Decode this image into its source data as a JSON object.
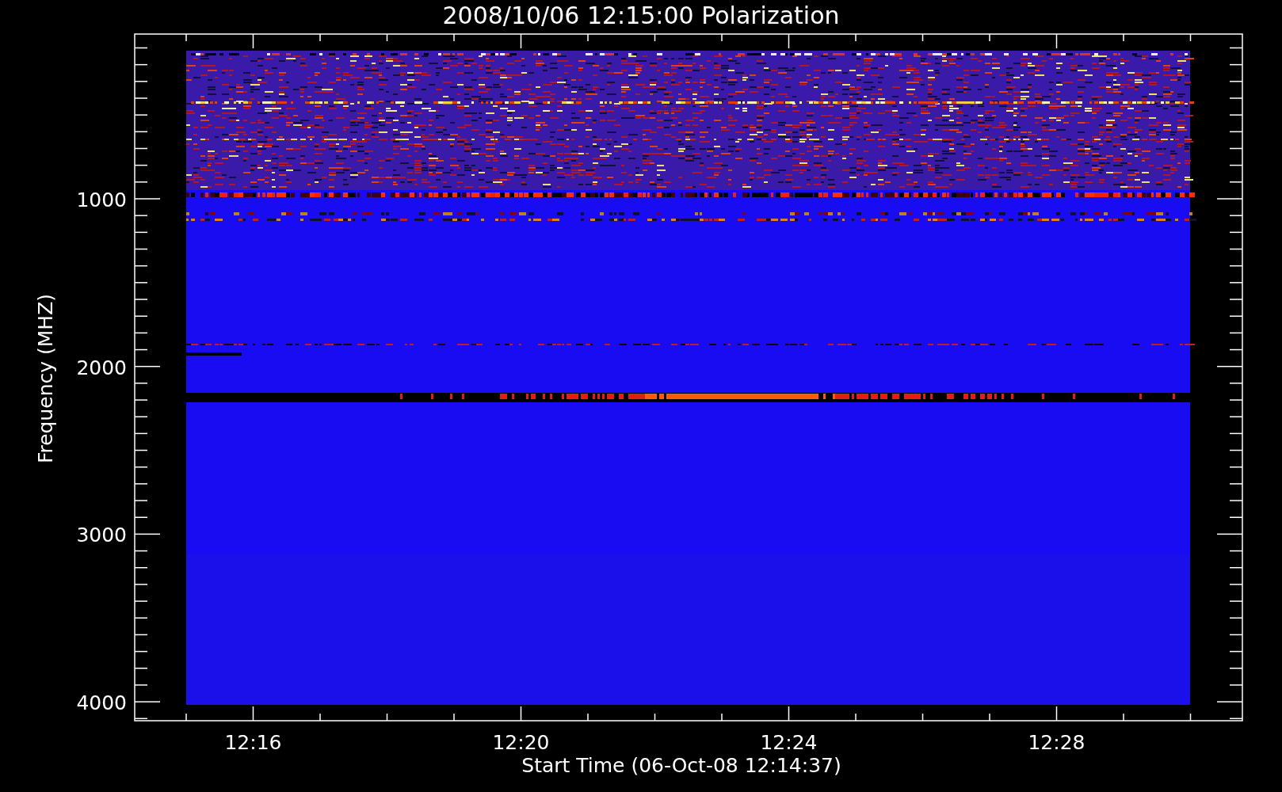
{
  "title": "2008/10/06 12:15:00 Polarization",
  "y_axis": {
    "label": "Frequency (MHZ)",
    "ticks": [
      "1000",
      "2000",
      "3000",
      "4000"
    ]
  },
  "x_axis": {
    "label": "Start Time (06-Oct-08 12:14:37)",
    "ticks": [
      "12:16",
      "12:20",
      "12:24",
      "12:28"
    ]
  }
}
